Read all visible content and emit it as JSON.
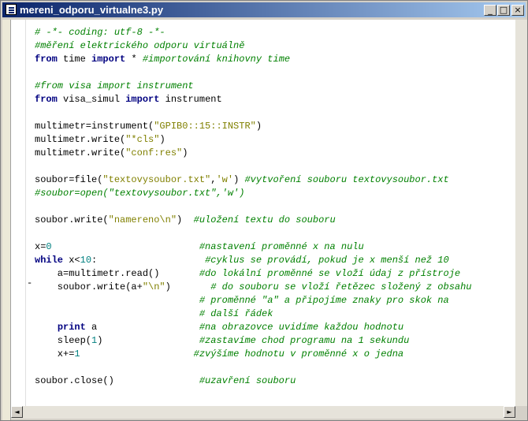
{
  "window": {
    "title": "mereni_odporu_virtualne3.py",
    "controls": {
      "minimize": "_",
      "maximize": "□",
      "close": "×"
    }
  },
  "editor": {
    "fold_marker": "-",
    "lines": [
      [
        [
          "cm",
          "# -*- coding: utf-8 -*-"
        ]
      ],
      [
        [
          "cm",
          "#měření elektrického odporu virtuálně"
        ]
      ],
      [
        [
          "kw",
          "from"
        ],
        [
          "",
          " time "
        ],
        [
          "kw",
          "import"
        ],
        [
          "",
          " * "
        ],
        [
          "cm",
          "#importování knihovny time"
        ]
      ],
      [],
      [
        [
          "cm",
          "#from visa import instrument"
        ]
      ],
      [
        [
          "kw",
          "from"
        ],
        [
          "",
          " visa_simul "
        ],
        [
          "kw",
          "import"
        ],
        [
          "",
          " instrument"
        ]
      ],
      [],
      [
        [
          "",
          "multimetr=instrument("
        ],
        [
          "st",
          "\"GPIB0::15::INSTR\""
        ],
        [
          "",
          ")"
        ]
      ],
      [
        [
          "",
          "multimetr.write("
        ],
        [
          "st",
          "\"*cls\""
        ],
        [
          "",
          ")"
        ]
      ],
      [
        [
          "",
          "multimetr.write("
        ],
        [
          "st",
          "\"conf:res\""
        ],
        [
          "",
          ")"
        ]
      ],
      [],
      [
        [
          "",
          "soubor=file("
        ],
        [
          "st",
          "\"textovysoubor.txt\""
        ],
        [
          "",
          ","
        ],
        [
          "st",
          "'w'"
        ],
        [
          "",
          ") "
        ],
        [
          "cm",
          "#vytvoření souboru textovysoubor.txt"
        ]
      ],
      [
        [
          "cm",
          "#soubor=open(\"textovysoubor.txt\",'w')"
        ]
      ],
      [],
      [
        [
          "",
          "soubor.write("
        ],
        [
          "st",
          "\"namereno\\n\""
        ],
        [
          "",
          ")  "
        ],
        [
          "cm",
          "#uložení textu do souboru"
        ]
      ],
      [],
      [
        [
          "",
          "x="
        ],
        [
          "nm",
          "0"
        ],
        [
          "",
          "                          "
        ],
        [
          "cm",
          "#nastavení proměnné x na nulu"
        ]
      ],
      [
        [
          "kw",
          "while"
        ],
        [
          "",
          " x<"
        ],
        [
          "nm",
          "10"
        ],
        [
          "",
          ":                   "
        ],
        [
          "cm",
          "#cyklus se provádí, pokud je x menší než 10"
        ]
      ],
      [
        [
          "",
          "    a=multimetr.read()       "
        ],
        [
          "cm",
          "#do lokální proměnné se vloží údaj z přístroje"
        ]
      ],
      [
        [
          "",
          "    soubor.write(a+"
        ],
        [
          "st",
          "\"\\n\""
        ],
        [
          "",
          ")       "
        ],
        [
          "cm",
          "# do souboru se vloží řetězec složený z obsahu"
        ]
      ],
      [
        [
          "",
          "                             "
        ],
        [
          "cm",
          "# proměnné \"a\" a připojíme znaky pro skok na"
        ]
      ],
      [
        [
          "",
          "                             "
        ],
        [
          "cm",
          "# další řádek"
        ]
      ],
      [
        [
          "",
          "    "
        ],
        [
          "kw",
          "print"
        ],
        [
          "",
          " a                  "
        ],
        [
          "cm",
          "#na obrazovce uvidíme každou hodnotu"
        ]
      ],
      [
        [
          "",
          "    sleep("
        ],
        [
          "nm",
          "1"
        ],
        [
          "",
          ")                 "
        ],
        [
          "cm",
          "#zastavíme chod programu na 1 sekundu"
        ]
      ],
      [
        [
          "",
          "    x+="
        ],
        [
          "nm",
          "1"
        ],
        [
          "",
          "                    "
        ],
        [
          "cm",
          "#zvýšíme hodnotu v proměnné x o jedna"
        ]
      ],
      [],
      [
        [
          "",
          "soubor.close()               "
        ],
        [
          "cm",
          "#uzavření souboru"
        ]
      ]
    ]
  },
  "scrollbars": {
    "left_arrow": "◄",
    "right_arrow": "►"
  }
}
